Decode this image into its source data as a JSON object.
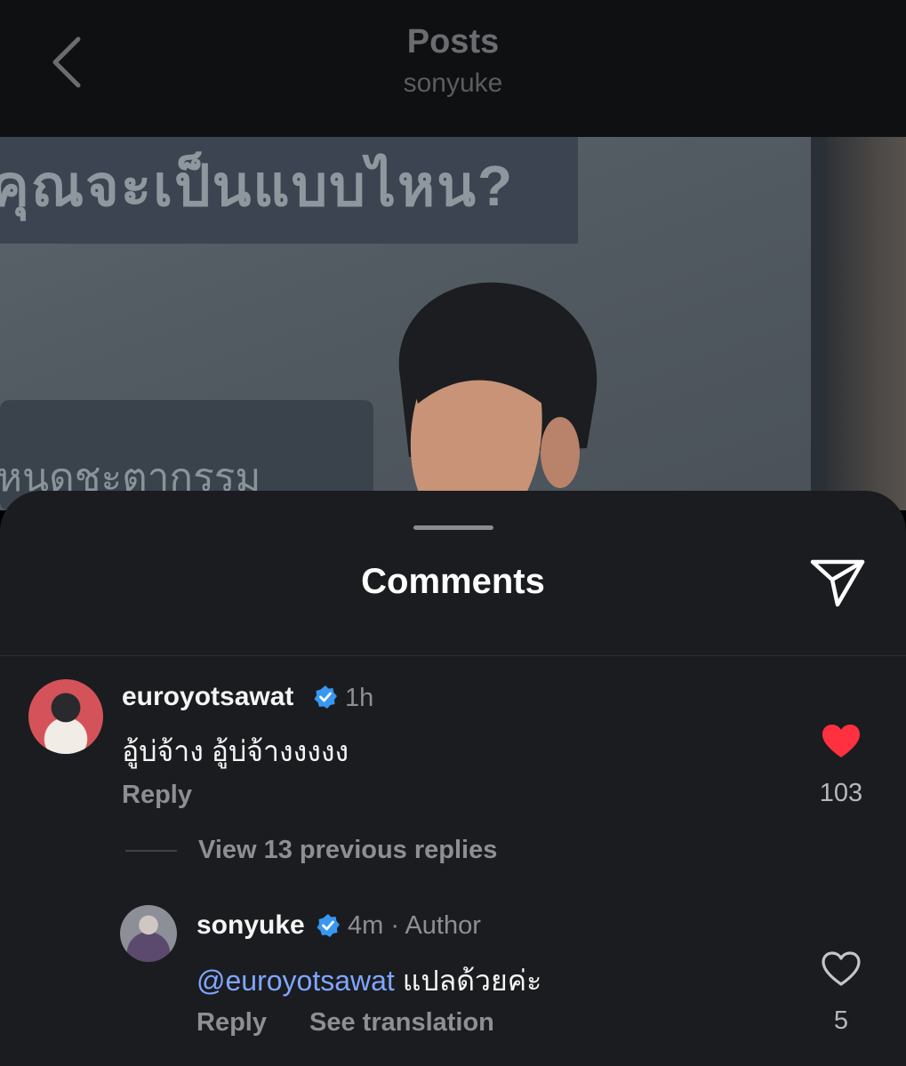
{
  "nav": {
    "title": "Posts",
    "subtitle": "sonyuke"
  },
  "photo": {
    "banner_text": "คุณจะเป็นแบบไหน?",
    "lower_text": "หนดชะตากรรม"
  },
  "sheet": {
    "title": "Comments"
  },
  "comments": [
    {
      "username": "euroyotsawat",
      "time": "1h",
      "text": "อู้บ่จ้าง อู้บ่จ้างงงงง",
      "reply_label": "Reply",
      "likes": "103",
      "liked": true,
      "view_replies": "View 13 previous replies"
    }
  ],
  "reply": {
    "username": "sonyuke",
    "meta": "4m · Author",
    "mention": "@euroyotsawat",
    "text": " แปลด้วยค่ะ",
    "reply_label": "Reply",
    "translate_label": "See translation",
    "likes": "5",
    "liked": false
  },
  "colors": {
    "like_red": "#ff3040",
    "verified_blue": "#3897f0",
    "mention_blue": "#7fa6ff"
  }
}
